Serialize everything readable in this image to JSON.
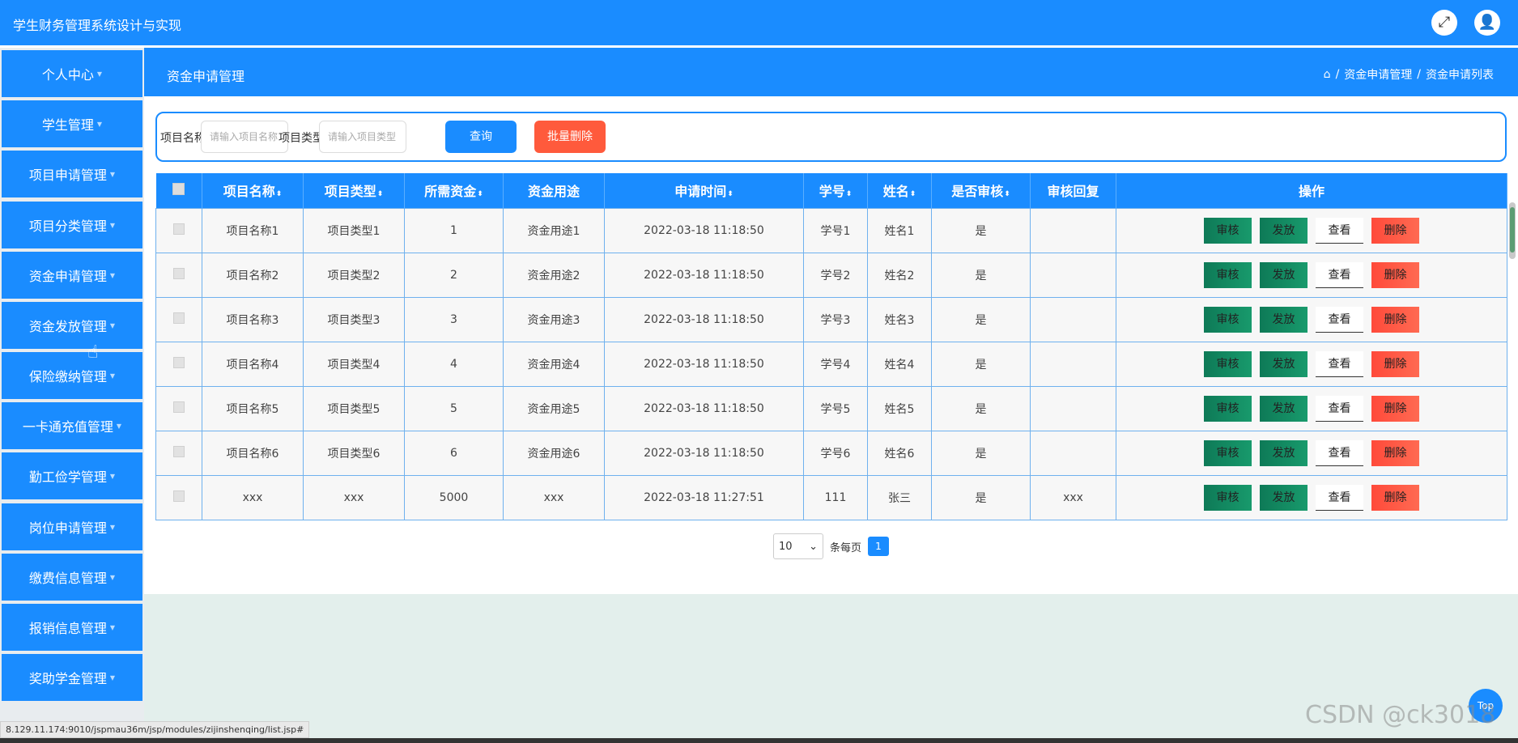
{
  "header": {
    "title": "学生财务管理系统设计与实现",
    "fullscreen_icon": "expand-icon",
    "user_icon": "user-icon"
  },
  "sidebar": {
    "items": [
      {
        "label": "个人中心"
      },
      {
        "label": "学生管理"
      },
      {
        "label": "项目申请管理"
      },
      {
        "label": "项目分类管理"
      },
      {
        "label": "资金申请管理"
      },
      {
        "label": "资金发放管理"
      },
      {
        "label": "保险缴纳管理"
      },
      {
        "label": "一卡通充值管理"
      },
      {
        "label": "勤工俭学管理"
      },
      {
        "label": "岗位申请管理"
      },
      {
        "label": "缴费信息管理"
      },
      {
        "label": "报销信息管理"
      },
      {
        "label": "奖助学金管理"
      }
    ]
  },
  "page": {
    "title": "资金申请管理",
    "breadcrumb": [
      "资金申请管理",
      "资金申请列表"
    ],
    "breadcrumb_sep": "/"
  },
  "search": {
    "name_label": "项目名称",
    "name_placeholder": "请输入项目名称",
    "type_label": "项目类型",
    "type_placeholder": "请输入项目类型",
    "query_label": "查询",
    "batch_delete_label": "批量删除"
  },
  "table": {
    "columns": [
      "项目名称",
      "项目类型",
      "所需资金",
      "资金用途",
      "申请时间",
      "学号",
      "姓名",
      "是否审核",
      "审核回复",
      "操作"
    ],
    "rows": [
      {
        "name": "项目名称1",
        "type": "项目类型1",
        "funds": "1",
        "usage": "资金用途1",
        "time": "2022-03-18 11:18:50",
        "student_no": "学号1",
        "student_name": "姓名1",
        "reviewed": "是",
        "reply": ""
      },
      {
        "name": "项目名称2",
        "type": "项目类型2",
        "funds": "2",
        "usage": "资金用途2",
        "time": "2022-03-18 11:18:50",
        "student_no": "学号2",
        "student_name": "姓名2",
        "reviewed": "是",
        "reply": ""
      },
      {
        "name": "项目名称3",
        "type": "项目类型3",
        "funds": "3",
        "usage": "资金用途3",
        "time": "2022-03-18 11:18:50",
        "student_no": "学号3",
        "student_name": "姓名3",
        "reviewed": "是",
        "reply": ""
      },
      {
        "name": "项目名称4",
        "type": "项目类型4",
        "funds": "4",
        "usage": "资金用途4",
        "time": "2022-03-18 11:18:50",
        "student_no": "学号4",
        "student_name": "姓名4",
        "reviewed": "是",
        "reply": ""
      },
      {
        "name": "项目名称5",
        "type": "项目类型5",
        "funds": "5",
        "usage": "资金用途5",
        "time": "2022-03-18 11:18:50",
        "student_no": "学号5",
        "student_name": "姓名5",
        "reviewed": "是",
        "reply": ""
      },
      {
        "name": "项目名称6",
        "type": "项目类型6",
        "funds": "6",
        "usage": "资金用途6",
        "time": "2022-03-18 11:18:50",
        "student_no": "学号6",
        "student_name": "姓名6",
        "reviewed": "是",
        "reply": ""
      },
      {
        "name": "xxx",
        "type": "xxx",
        "funds": "5000",
        "usage": "xxx",
        "time": "2022-03-18 11:27:51",
        "student_no": "111",
        "student_name": "张三",
        "reviewed": "是",
        "reply": "xxx"
      }
    ],
    "actions": {
      "audit": "审核",
      "issue": "发放",
      "view": "查看",
      "delete": "删除"
    }
  },
  "pagination": {
    "page_size": "10",
    "per_page_label": "条每页",
    "current_page": "1"
  },
  "to_top_label": "Top",
  "status_url": "8.129.11.174:9010/jspmau36m/jsp/modules/zijinshenqing/list.jsp#",
  "watermark": "CSDN @ck3018",
  "colors": {
    "primary": "#1a8cff",
    "danger": "#ff5a3c",
    "success": "#0e7a57",
    "footer_bg": "#e3efec"
  }
}
